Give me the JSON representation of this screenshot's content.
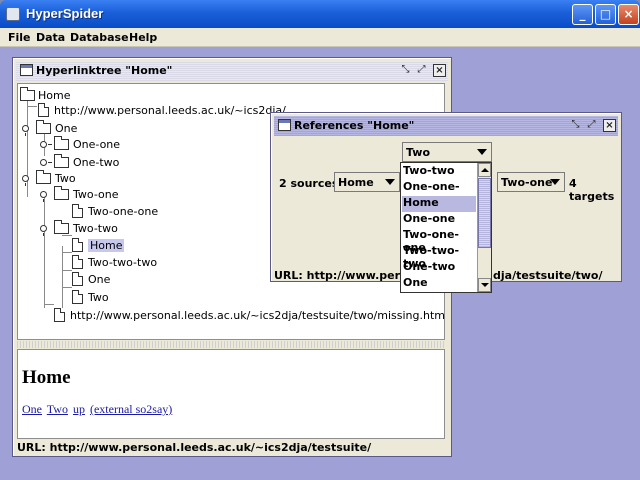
{
  "app": {
    "title": "HyperSpider",
    "menu": [
      "File",
      "Data",
      "Database",
      "Help"
    ]
  },
  "hyperlinktree": {
    "title": "Hyperlinktree \"Home\"",
    "nodes": {
      "home": "Home",
      "home_url": "http://www.personal.leeds.ac.uk/~ics2dja/",
      "one": "One",
      "one_one": "One-one",
      "one_two": "One-two",
      "two": "Two",
      "two_one": "Two-one",
      "two_one_one": "Two-one-one",
      "two_two": "Two-two",
      "two_two_home": "Home",
      "two_two_two": "Two-two-two",
      "two_two_one": "One",
      "two_two_twoleaf": "Two",
      "missing_url": "http://www.personal.leeds.ac.uk/~ics2dja/testsuite/two/missing.htm"
    },
    "content": {
      "heading": "Home",
      "links": [
        "One",
        "Two",
        "up",
        "(external so2say)"
      ]
    },
    "status": "URL: http://www.personal.leeds.ac.uk/~ics2dja/testsuite/"
  },
  "references": {
    "title": "References \"Home\"",
    "sources_label": "2 sources",
    "sources_value": "Home",
    "center_value": "Two",
    "targets_value": "Two-one",
    "targets_label": "4 targets",
    "status_left": "URL: http://www.personal",
    "status_right": "dja/testsuite/two/",
    "dropdown_options": [
      "Two-two",
      "One-one-one",
      "Home",
      "One-one",
      "Two-one-one",
      "Two-two-two",
      "One-two",
      "One"
    ],
    "highlighted_option": "Home"
  },
  "colors": {
    "titlebar": "#1a5fd8",
    "desktop": "#9fa0d6",
    "selection": "#c8c8ee"
  }
}
